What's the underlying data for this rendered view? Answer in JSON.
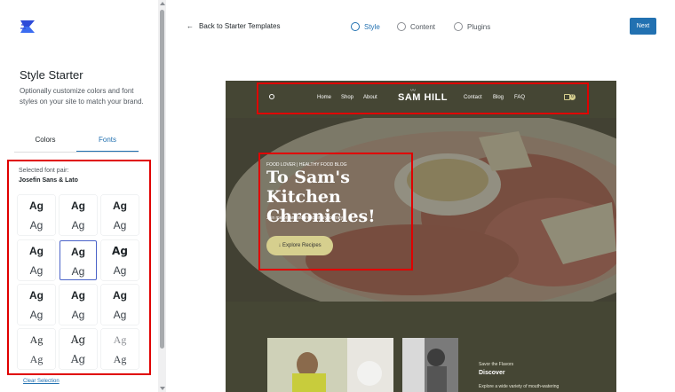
{
  "sidebar": {
    "title": "Style Starter",
    "description": "Optionally customize colors and font styles on your site to match your brand.",
    "tabs": [
      {
        "label": "Colors",
        "active": false
      },
      {
        "label": "Fonts",
        "active": true
      }
    ],
    "selected_label": "Selected font pair:",
    "selected_value": "Josefin Sans & Lato",
    "font_pairs": [
      {
        "heading": "Ag",
        "body": "Ag"
      },
      {
        "heading": "Ag",
        "body": "Ag"
      },
      {
        "heading": "Ag",
        "body": "Ag"
      },
      {
        "heading": "Ag",
        "body": "Ag"
      },
      {
        "heading": "Ag",
        "body": "Ag",
        "selected": true
      },
      {
        "heading": "Ag",
        "body": "Ag"
      },
      {
        "heading": "Ag",
        "body": "Ag"
      },
      {
        "heading": "Ag",
        "body": "Ag"
      },
      {
        "heading": "Ag",
        "body": "Ag"
      },
      {
        "heading": "Ag",
        "body": "Ag"
      },
      {
        "heading": "Ag",
        "body": "Ag"
      },
      {
        "heading": "Ag",
        "body": "Ag"
      }
    ],
    "clear_selection": "Clear Selection"
  },
  "topbar": {
    "back_label": "Back to Starter Templates",
    "steps": [
      {
        "label": "Style",
        "active": true
      },
      {
        "label": "Content",
        "active": false
      },
      {
        "label": "Plugins",
        "active": false
      }
    ],
    "next_label": "Next"
  },
  "preview": {
    "brand": "SAM HILL",
    "nav_left": [
      "Home",
      "Shop",
      "About"
    ],
    "nav_right": [
      "Contact",
      "Blog",
      "FAQ"
    ],
    "cart_count": "0",
    "hero_tag": "FOOD LOVER | HEALTHY FOOD BLOG",
    "hero_title": "To Sam's Kitchen Chronicles!",
    "hero_sub": "Join me on an exciting culinary journey!",
    "hero_button": "Explore Recipes",
    "section_tag": "Savor the Flavors",
    "section_title": "Discover",
    "section_text": "Explore a wide variety of mouth-watering"
  },
  "colors": {
    "accent": "#2271b1",
    "highlight": "#e00000",
    "site_bg": "#454634",
    "site_button": "#d6cf8e"
  }
}
